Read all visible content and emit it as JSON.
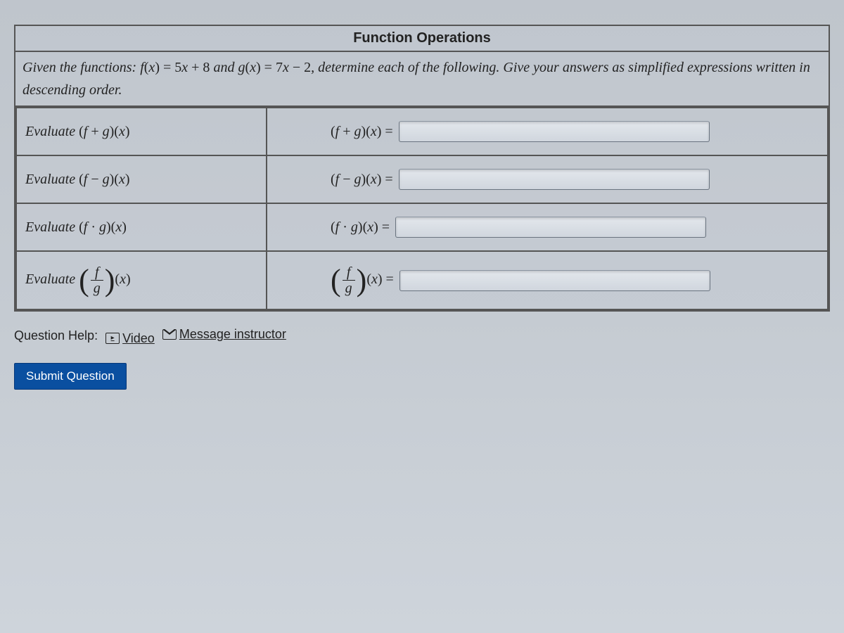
{
  "title": "Function Operations",
  "instructions_prefix": "Given the functions: ",
  "f_def": "f(x) = 5x + 8",
  "instructions_mid": " and ",
  "g_def": "g(x) = 7x − 2",
  "instructions_suffix": ", determine each of the following. Give your answers as simplified expressions written in descending order.",
  "rows": [
    {
      "prompt": "Evaluate (f + g)(x)",
      "rhs_label": "(f + g)(x) ="
    },
    {
      "prompt": "Evaluate (f − g)(x)",
      "rhs_label": "(f − g)(x) ="
    },
    {
      "prompt": "Evaluate (f · g)(x)",
      "rhs_label": "(f · g)(x) ="
    },
    {
      "prompt": "Evaluate (f/g)(x)",
      "rhs_label": "(f/g)(x) ="
    }
  ],
  "help_label": "Question Help:",
  "video_label": "Video",
  "message_label": "Message instructor",
  "submit_label": "Submit Question"
}
